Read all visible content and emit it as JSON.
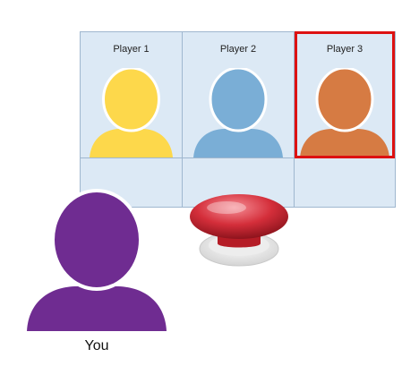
{
  "players": [
    {
      "label": "Player 1",
      "color": "#fdd84b",
      "selected": false
    },
    {
      "label": "Player 2",
      "color": "#7aaed6",
      "selected": false
    },
    {
      "label": "Player 3",
      "color": "#d67b43",
      "selected": true
    }
  ],
  "you": {
    "label": "You",
    "color": "#6f2c91"
  },
  "buzzer": {
    "color": "#d42e3a",
    "icon": "buzzer-button-icon"
  },
  "highlight_color": "#dd1111"
}
